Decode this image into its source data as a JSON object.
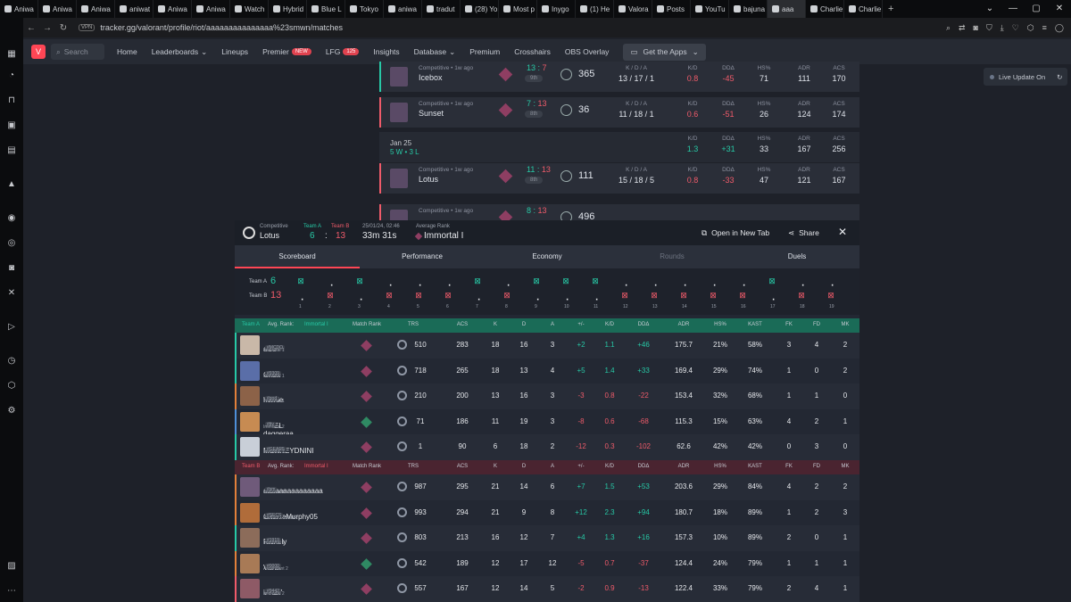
{
  "browser": {
    "tabs": [
      "Aniwa",
      "Aniwa",
      "Aniwa",
      "aniwat",
      "Aniwa",
      "Aniwa",
      "Watch",
      "Hybrid",
      "Blue L",
      "Tokyo",
      "aniwa",
      "tradut",
      "(28) Yo",
      "Most p",
      "Inygo",
      "(1) He",
      "Valora",
      "Posts",
      "YouTu",
      "bajuna",
      "aaa",
      "Charlie",
      "Charlie"
    ],
    "new_tab": "+",
    "window_controls": [
      "⌄",
      "—",
      "▢",
      "✕"
    ],
    "vpn": "VPN",
    "url": "tracker.gg/valorant/profile/riot/aaaaaaaaaaaaaaa%23smwn/matches"
  },
  "site_nav": {
    "logo": "V",
    "search_placeholder": "Search",
    "items": [
      "Home",
      "Leaderboards",
      "Lineups",
      "Premier",
      "LFG",
      "Insights",
      "Database",
      "Premium",
      "Crosshairs",
      "OBS Overlay"
    ],
    "premier_badge": "NEW",
    "lfg_badge": "125",
    "get_apps": "Get the Apps",
    "live_update": "Live Update On"
  },
  "matches": [
    {
      "queue": "Competitive • 1w ago",
      "map": "Icebox",
      "score_w": "13",
      "score_l": "7",
      "place": "9th",
      "rr": "365",
      "kda": "13 / 17 / 1",
      "kd": "0.8",
      "dda": "-45",
      "hs": "71",
      "adr": "111",
      "acs": "170",
      "win": true
    },
    {
      "queue": "Competitive • 1w ago",
      "map": "Sunset",
      "score_w": "7",
      "score_l": "13",
      "place": "8th",
      "rr": "36",
      "kda": "11 / 18 / 1",
      "kd": "0.6",
      "dda": "-51",
      "hs": "26",
      "adr": "124",
      "acs": "174",
      "win": false
    },
    {
      "queue": "Competitive • 1w ago",
      "map": "Lotus",
      "score_w": "11",
      "score_l": "13",
      "place": "8th",
      "rr": "111",
      "kda": "15 / 18 / 5",
      "kd": "0.8",
      "dda": "-33",
      "hs": "47",
      "adr": "121",
      "acs": "167",
      "win": false
    },
    {
      "queue": "Competitive • 1w ago",
      "map": "",
      "score_w": "8",
      "score_l": "13",
      "place": "",
      "rr": "496",
      "kda": "",
      "kd": "",
      "dda": "",
      "hs": "",
      "adr": "",
      "acs": "",
      "win": false
    }
  ],
  "day_summary": {
    "date": "Jan 25",
    "wl": "5 W • 3 L",
    "kd": "1.3",
    "dda": "+31",
    "hs": "33",
    "adr": "167",
    "acs": "256"
  },
  "stat_heads": {
    "kda": "K / D / A",
    "kd": "K/D",
    "dda": "DDΔ",
    "hs": "HS%",
    "adr": "ADR",
    "acs": "ACS"
  },
  "modal": {
    "mode": "Competitive",
    "map": "Lotus",
    "team_a_label": "Team A",
    "team_b_label": "Team B",
    "team_a_score": "6",
    "team_b_score": "13",
    "date": "25/01/24, 02:46",
    "duration": "33m 31s",
    "avg_rank_label": "Average Rank",
    "avg_rank": "Immortal I",
    "open_new_tab": "Open in New Tab",
    "share": "Share",
    "tabs": [
      "Scoreboard",
      "Performance",
      "Economy",
      "Rounds",
      "Duels"
    ],
    "timeline_a_label": "Team A",
    "timeline_b_label": "Team B",
    "rounds": [
      "A",
      "B",
      "A",
      "B",
      "B",
      "B",
      "A",
      "B",
      "A",
      "A",
      "A",
      "B",
      "B",
      "B",
      "B",
      "B",
      "A",
      "B",
      "B"
    ]
  },
  "columns": [
    "Match Rank",
    "TRS",
    "ACS",
    "K",
    "D",
    "A",
    "+/-",
    "K/D",
    "DDΔ",
    "ADR",
    "HS%",
    "KAST",
    "FK",
    "FD",
    "MK"
  ],
  "team_a_header": {
    "team": "Team A",
    "avg": "Avg. Rank:",
    "rank": "Immortal I"
  },
  "team_b_header": {
    "team": "Team B",
    "avg": "Avg. Rank:",
    "rank": "Immortal I"
  },
  "team_a": [
    {
      "name": "aCe",
      "tag": "#MCDO",
      "rank": "Immortal 1",
      "trs": "510",
      "acs": "283",
      "k": "18",
      "d": "16",
      "a": "3",
      "pm": "+2",
      "kd": "1.1",
      "dda": "+46",
      "adr": "175.7",
      "hs": "21%",
      "kast": "58%",
      "fk": "3",
      "fd": "4",
      "mk": "2"
    },
    {
      "name": "Ghstt",
      "tag": "#9309",
      "rank": "Immortal 1",
      "trs": "718",
      "acs": "265",
      "k": "18",
      "d": "13",
      "a": "4",
      "pm": "+5",
      "kd": "1.4",
      "dda": "+33",
      "adr": "169.4",
      "hs": "29%",
      "kast": "74%",
      "fk": "1",
      "fd": "0",
      "mk": "2"
    },
    {
      "name": "hornie",
      "tag": "#god",
      "rank": "Immortal 1",
      "trs": "210",
      "acs": "200",
      "k": "13",
      "d": "16",
      "a": "3",
      "pm": "-3",
      "kd": "0.8",
      "dda": "-22",
      "adr": "153.4",
      "hs": "32%",
      "kast": "68%",
      "fk": "1",
      "fd": "1",
      "mk": "0"
    },
    {
      "name": "EL daggeraa",
      "tag": "#ttv",
      "rank": "Immortal 2",
      "trs": "71",
      "acs": "186",
      "k": "11",
      "d": "19",
      "a": "3",
      "pm": "-8",
      "kd": "0.6",
      "dda": "-68",
      "adr": "115.3",
      "hs": "15%",
      "kast": "63%",
      "fk": "4",
      "fd": "2",
      "mk": "1"
    },
    {
      "name": "MONKEYDNINI",
      "tag": "#GEAR5",
      "rank": "Immortal 2",
      "trs": "1",
      "acs": "90",
      "k": "6",
      "d": "18",
      "a": "2",
      "pm": "-12",
      "kd": "0.3",
      "dda": "-102",
      "adr": "62.6",
      "hs": "42%",
      "kast": "42%",
      "fk": "0",
      "fd": "3",
      "mk": "0"
    }
  ],
  "team_b": [
    {
      "name": "aaaaaaaaaaaaaaa",
      "tag": "#sm",
      "rank": "Immortal 1",
      "trs": "987",
      "acs": "295",
      "k": "21",
      "d": "14",
      "a": "6",
      "pm": "+7",
      "kd": "1.5",
      "dda": "+53",
      "adr": "203.6",
      "hs": "29%",
      "kast": "84%",
      "fk": "4",
      "fd": "2",
      "mk": "2"
    },
    {
      "name": "CharlieMurphy05",
      "tag": "#SECS",
      "rank": "Radiant • 556 RR",
      "trs": "993",
      "acs": "294",
      "k": "21",
      "d": "9",
      "a": "8",
      "pm": "+12",
      "kd": "2.3",
      "dda": "+94",
      "adr": "180.7",
      "hs": "18%",
      "kast": "89%",
      "fk": "1",
      "fd": "2",
      "mk": "3"
    },
    {
      "name": "Richely",
      "tag": "#1919",
      "rank": "Immortal 1",
      "trs": "803",
      "acs": "213",
      "k": "16",
      "d": "12",
      "a": "7",
      "pm": "+4",
      "kd": "1.3",
      "dda": "+16",
      "adr": "157.3",
      "hs": "10%",
      "kast": "89%",
      "fk": "2",
      "fd": "0",
      "mk": "1"
    },
    {
      "name": "VitKill",
      "tag": "#0000",
      "rank": "Ascendant 2",
      "trs": "542",
      "acs": "189",
      "k": "12",
      "d": "17",
      "a": "12",
      "pm": "-5",
      "kd": "0.7",
      "dda": "-37",
      "adr": "124.4",
      "hs": "24%",
      "kast": "79%",
      "fk": "1",
      "fd": "1",
      "mk": "1"
    },
    {
      "name": "iFKZ7",
      "tag": "#9442",
      "rank": "Immortal 2",
      "trs": "557",
      "acs": "167",
      "k": "12",
      "d": "14",
      "a": "5",
      "pm": "-2",
      "kd": "0.9",
      "dda": "-13",
      "adr": "122.4",
      "hs": "33%",
      "kast": "79%",
      "fk": "2",
      "fd": "4",
      "mk": "1"
    }
  ],
  "colors": {
    "win": "#27c9a6",
    "loss": "#ef5b6a",
    "accent": "#ff4655"
  }
}
